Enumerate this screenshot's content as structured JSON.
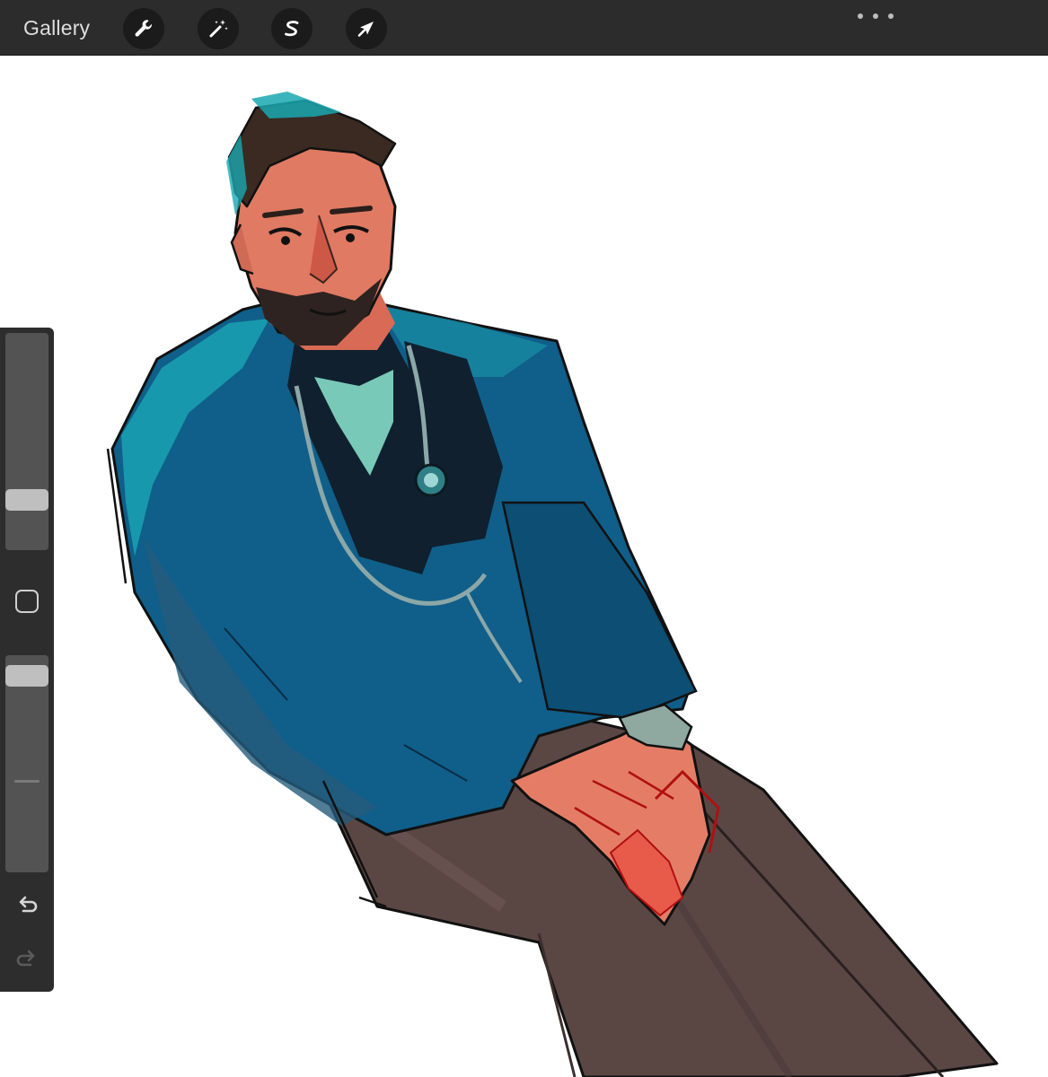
{
  "toolbar": {
    "gallery_label": "Gallery",
    "tools": [
      {
        "name": "actions",
        "icon": "wrench-icon"
      },
      {
        "name": "adjustments",
        "icon": "magic-wand-icon"
      },
      {
        "name": "selection",
        "icon": "selection-s-icon"
      },
      {
        "name": "transform",
        "icon": "arrow-cursor-icon"
      }
    ],
    "more_icon": "ellipsis-icon"
  },
  "sidebar": {
    "brush_size_level": 0.2,
    "opacity_level": 0.95,
    "icons": [
      "modify-square-icon",
      "undo-icon",
      "redo-icon"
    ]
  },
  "canvas": {
    "artwork": "illustration-doctor-in-blue-scrubs-with-stethoscope",
    "colors": {
      "jacket": "#0f5f8a",
      "jacket_highlight": "#1a9fb0",
      "scrubs_dark": "#10202e",
      "pants": "#5a4744",
      "skin": "#e07a62",
      "hair": "#3a2a22",
      "outline": "#111111"
    }
  },
  "colors": {
    "toolbar_bg": "#2c2c2c",
    "button_bg": "#1b1b1b",
    "sidebar_bg": "#2d2d2d",
    "text": "#dedede"
  }
}
